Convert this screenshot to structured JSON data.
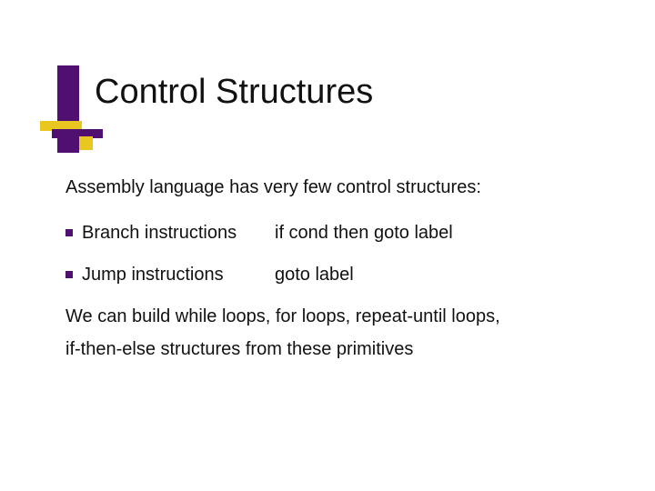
{
  "title": "Control Structures",
  "content": {
    "intro": "Assembly language has very few control structures:",
    "items": [
      {
        "label": "Branch instructions",
        "desc": "if cond then goto label"
      },
      {
        "label": "Jump instructions",
        "desc": "goto label"
      }
    ],
    "outro1": "We can build while loops, for loops, repeat-until loops,",
    "outro2": "if-then-else structures from these primitives"
  }
}
